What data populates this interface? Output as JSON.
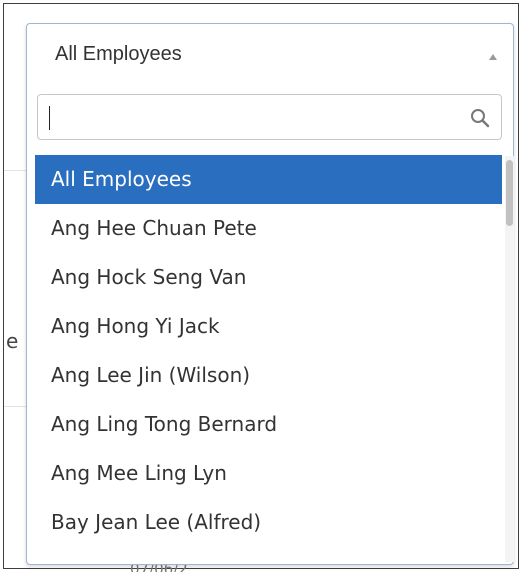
{
  "select": {
    "selected_label": "All Employees",
    "search_value": "",
    "options": [
      "All Employees",
      "Ang Hee Chuan Pete",
      "Ang Hock Seng Van",
      "Ang Hong Yi Jack",
      "Ang Lee Jin (Wilson)",
      "Ang Ling Tong Bernard",
      "Ang Mee Ling Lyn",
      "Bay Jean Lee (Alfred)"
    ],
    "highlighted_index": 0
  },
  "background": {
    "fragment_text": "e",
    "bottom_text": "                              07/06/2"
  },
  "colors": {
    "highlight": "#2a6ebf",
    "border": "#9fb6cd"
  },
  "icons": {
    "arrow": "caret-up-icon",
    "search": "magnifier-icon"
  }
}
